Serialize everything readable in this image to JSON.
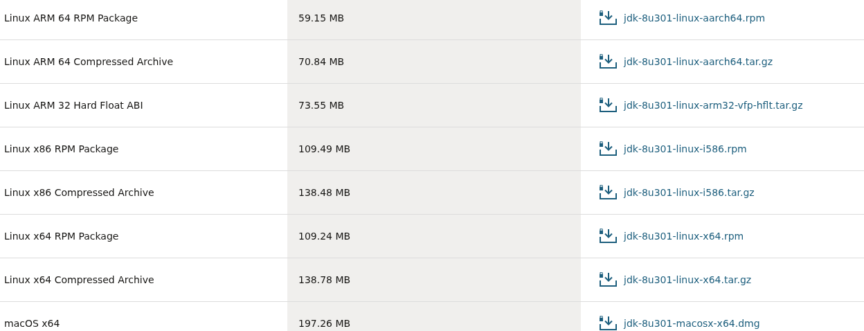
{
  "table": {
    "rows": [
      {
        "product": "Linux ARM 64 RPM Package",
        "size": "59.15 MB",
        "file": "jdk-8u301-linux-aarch64.rpm"
      },
      {
        "product": "Linux ARM 64 Compressed Archive",
        "size": "70.84 MB",
        "file": "jdk-8u301-linux-aarch64.tar.gz"
      },
      {
        "product": "Linux ARM 32 Hard Float ABI",
        "size": "73.55 MB",
        "file": "jdk-8u301-linux-arm32-vfp-hflt.tar.gz"
      },
      {
        "product": "Linux x86 RPM Package",
        "size": "109.49 MB",
        "file": "jdk-8u301-linux-i586.rpm"
      },
      {
        "product": "Linux x86 Compressed Archive",
        "size": "138.48 MB",
        "file": "jdk-8u301-linux-i586.tar.gz"
      },
      {
        "product": "Linux x64 RPM Package",
        "size": "109.24 MB",
        "file": "jdk-8u301-linux-x64.rpm"
      },
      {
        "product": "Linux x64 Compressed Archive",
        "size": "138.78 MB",
        "file": "jdk-8u301-linux-x64.tar.gz"
      },
      {
        "product": "macOS x64",
        "size": "197.26 MB",
        "file": "jdk-8u301-macosx-x64.dmg"
      }
    ]
  }
}
